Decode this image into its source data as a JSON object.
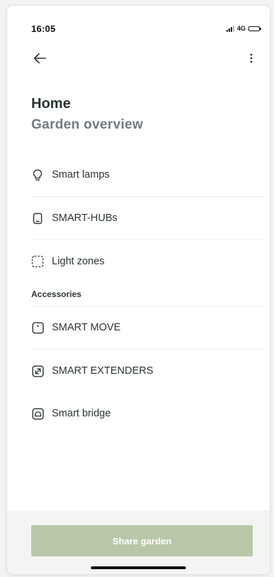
{
  "status_bar": {
    "time": "16:05",
    "network": "4G"
  },
  "app_bar": {
    "back_icon": "arrow-left-icon",
    "more_icon": "more-vertical-icon"
  },
  "header": {
    "title": "Home",
    "subtitle": "Garden overview"
  },
  "main_list": {
    "items": [
      {
        "label": "Smart lamps",
        "icon": "lightbulb-icon"
      },
      {
        "label": "SMART-HUBs",
        "icon": "hub-device-icon"
      },
      {
        "label": "Light zones",
        "icon": "dashed-square-icon"
      }
    ]
  },
  "accessories": {
    "header": "Accessories",
    "items": [
      {
        "label": "SMART MOVE",
        "icon": "motion-sensor-icon"
      },
      {
        "label": "SMART EXTENDERS",
        "icon": "expand-arrow-icon"
      },
      {
        "label": "Smart bridge",
        "icon": "bridge-icon"
      }
    ]
  },
  "footer": {
    "share_label": "Share garden"
  },
  "colors": {
    "primary_button": "#b8c7a8",
    "text_dark": "#2b3437",
    "text_muted": "#6f7b7f"
  }
}
